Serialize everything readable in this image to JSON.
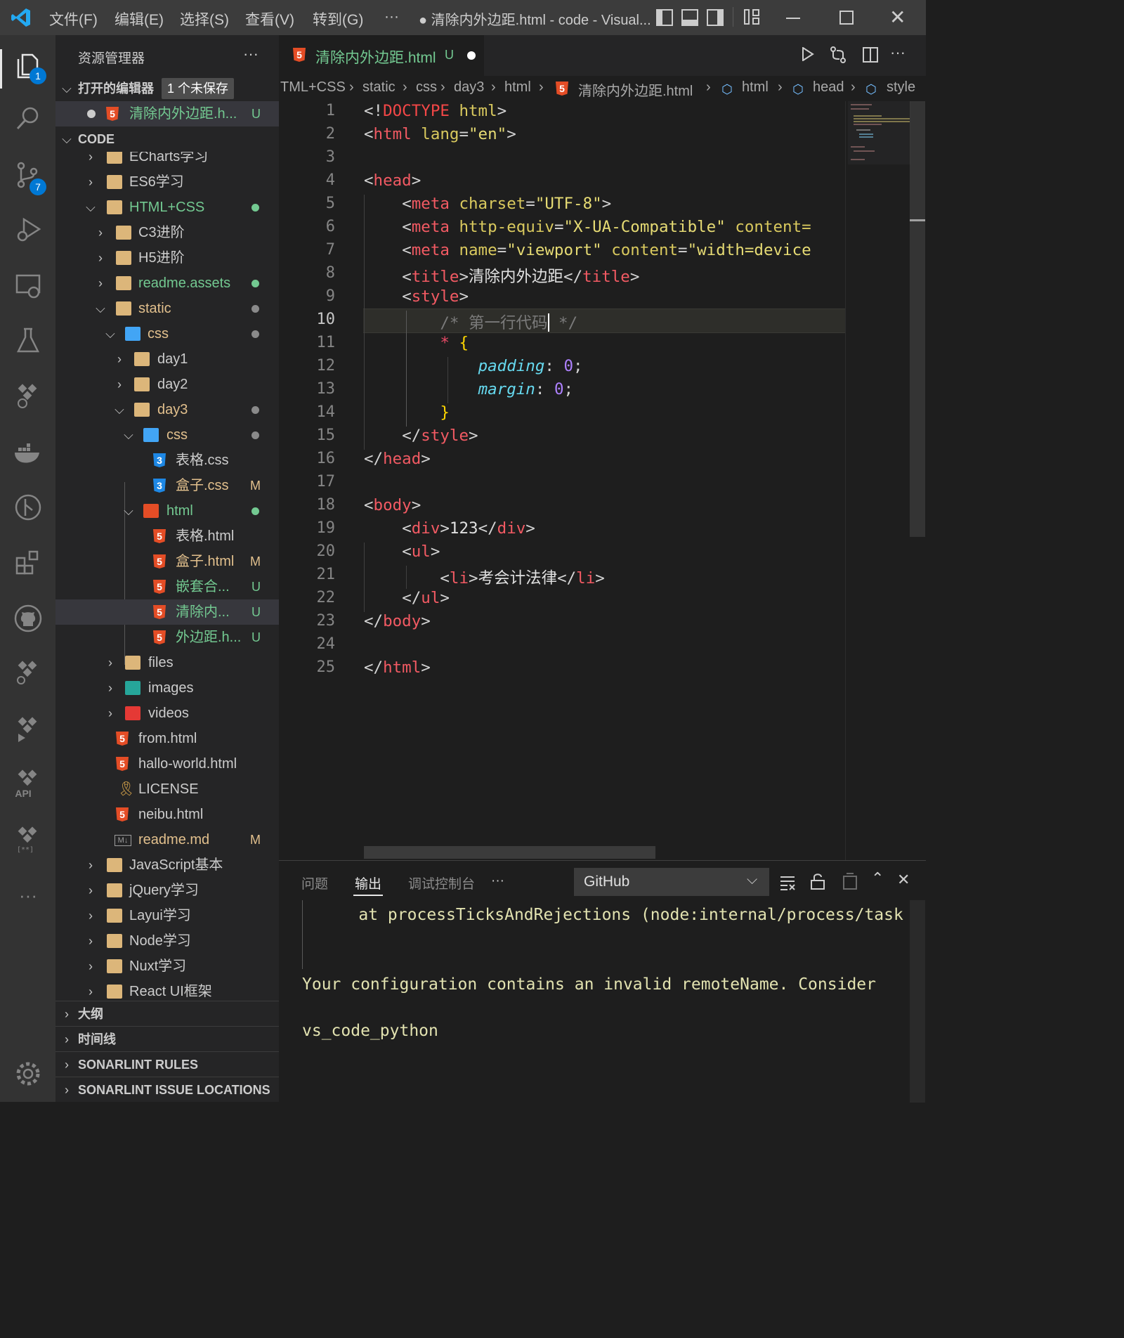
{
  "titlebar": {
    "menus": [
      "文件(F)",
      "编辑(E)",
      "选择(S)",
      "查看(V)",
      "转到(G)"
    ],
    "more": "···",
    "title": "● 清除内外边距.html - code - Visual...",
    "accent": "#0078d4"
  },
  "activity": {
    "explorer_badge": "1",
    "scm_badge": "7",
    "api_label": "API",
    "more": "···"
  },
  "sidebar": {
    "title": "资源管理器",
    "more": "···",
    "open_editors_label": "打开的编辑器",
    "unsaved_badge": "1 个未保存",
    "open_editor_file": "清除内外边距.h...",
    "open_editor_status": "U",
    "workspace_label": "CODE",
    "tree": [
      {
        "label": "ECharts学习",
        "status": ""
      },
      {
        "label": "ES6学习",
        "status": ""
      },
      {
        "label": "HTML+CSS",
        "status": ""
      },
      {
        "label": "C3进阶",
        "status": ""
      },
      {
        "label": "H5进阶",
        "status": ""
      },
      {
        "label": "readme.assets",
        "status": ""
      },
      {
        "label": "static",
        "status": ""
      },
      {
        "label": "css",
        "status": ""
      },
      {
        "label": "day1",
        "status": ""
      },
      {
        "label": "day2",
        "status": ""
      },
      {
        "label": "day3",
        "status": ""
      },
      {
        "label": "css",
        "status": ""
      },
      {
        "label": "表格.css",
        "status": ""
      },
      {
        "label": "盒子.css",
        "status": "M"
      },
      {
        "label": "html",
        "status": ""
      },
      {
        "label": "表格.html",
        "status": ""
      },
      {
        "label": "盒子.html",
        "status": "M"
      },
      {
        "label": "嵌套合...",
        "status": "U"
      },
      {
        "label": "清除内...",
        "status": "U"
      },
      {
        "label": "外边距.h...",
        "status": "U"
      },
      {
        "label": "files",
        "status": ""
      },
      {
        "label": "images",
        "status": ""
      },
      {
        "label": "videos",
        "status": ""
      },
      {
        "label": "from.html",
        "status": ""
      },
      {
        "label": "hallo-world.html",
        "status": ""
      },
      {
        "label": "LICENSE",
        "status": ""
      },
      {
        "label": "neibu.html",
        "status": ""
      },
      {
        "label": "readme.md",
        "status": "M"
      },
      {
        "label": "JavaScript基本",
        "status": ""
      },
      {
        "label": "jQuery学习",
        "status": ""
      },
      {
        "label": "Layui学习",
        "status": ""
      },
      {
        "label": "Node学习",
        "status": ""
      },
      {
        "label": "Nuxt学习",
        "status": ""
      },
      {
        "label": "React UI框架",
        "status": ""
      }
    ],
    "sections": [
      "大纲",
      "时间线",
      "SONARLINT RULES",
      "SONARLINT ISSUE LOCATIONS"
    ]
  },
  "editor": {
    "tab_label": "清除内外边距.html",
    "tab_status": "U",
    "breadcrumb": [
      "TML+CSS",
      "static",
      "css",
      "day3",
      "html",
      "清除内外边距.html",
      "html",
      "head",
      "style"
    ],
    "line_numbers": [
      "1",
      "2",
      "3",
      "4",
      "5",
      "6",
      "7",
      "8",
      "9",
      "10",
      "11",
      "12",
      "13",
      "14",
      "15",
      "16",
      "17",
      "18",
      "19",
      "20",
      "21",
      "22",
      "23",
      "24",
      "25"
    ],
    "current_line": "10"
  },
  "panel": {
    "tabs": [
      "问题",
      "输出",
      "调试控制台"
    ],
    "active_tab": "输出",
    "more": "···",
    "channel": "GitHub",
    "output_lines": [
      "    at processTicksAndRejections (node:internal/process/task",
      "Your configuration contains an invalid remoteName. Consider",
      "vs_code_python"
    ]
  }
}
